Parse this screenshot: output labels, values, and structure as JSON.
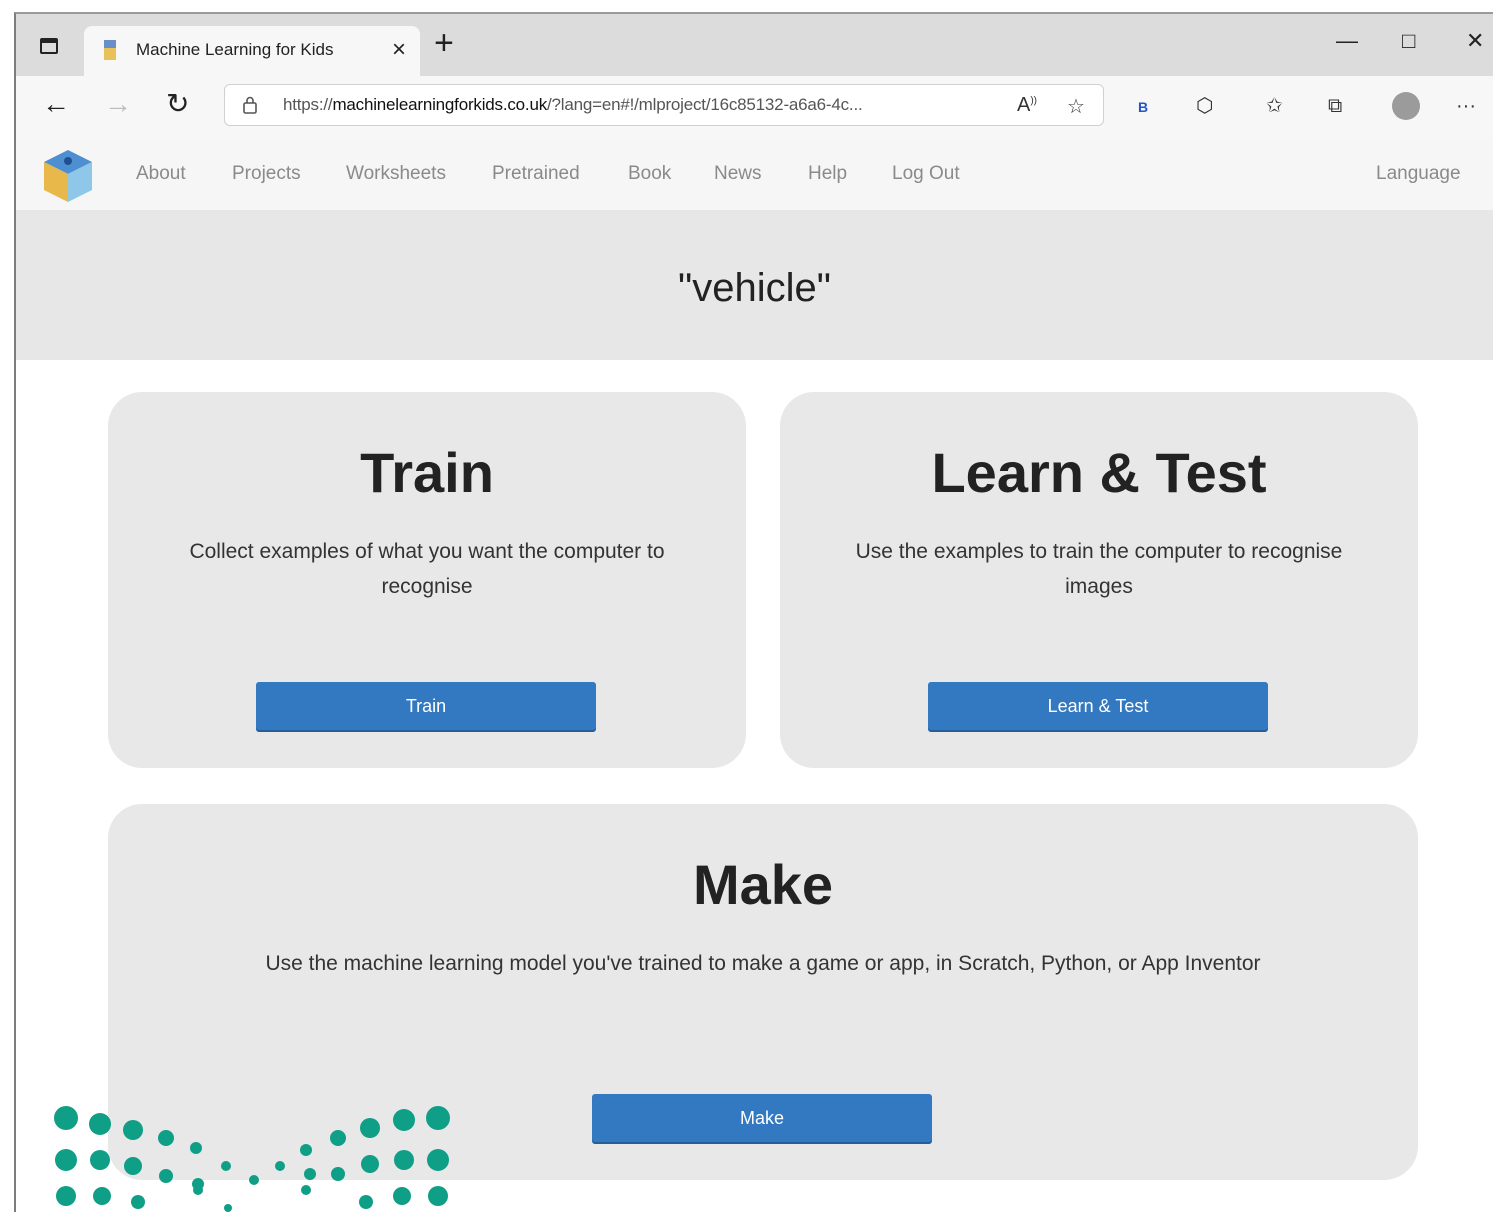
{
  "browser": {
    "tab_title": "Machine Learning for Kids",
    "tab_close": "×",
    "new_tab": "+",
    "window_controls": {
      "minimize": "—",
      "maximize": "□",
      "close": "✕"
    },
    "nav_buttons": {
      "back": "←",
      "forward": "→",
      "refresh": "↻"
    },
    "url_prefix": "https://",
    "url_host": "machinelearningforkids.co.uk",
    "url_path": "/?lang=en#!/mlproject/16c85132-a6a6-4c...",
    "menu": "···"
  },
  "site_nav": {
    "links": [
      "About",
      "Projects",
      "Worksheets",
      "Pretrained",
      "Book",
      "News",
      "Help",
      "Log Out"
    ],
    "language": "Language"
  },
  "project": {
    "title": "\"vehicle\""
  },
  "cards": {
    "train": {
      "heading": "Train",
      "description_line1": "Collect examples of what you want the computer to",
      "description_line2": "recognise",
      "button": "Train"
    },
    "learn": {
      "heading": "Learn & Test",
      "description_line1": "Use the examples to train the computer to recognise",
      "description_line2": "images",
      "button": "Learn & Test"
    },
    "make": {
      "heading": "Make",
      "description": "Use the machine learning model you've trained to make a game or app, in Scratch, Python, or App Inventor",
      "button": "Make"
    }
  },
  "colors": {
    "button_blue": "#3279c1",
    "card_bg": "#e8e8e8",
    "title_band": "#e7e7e7",
    "decoration_teal": "#0f9e86"
  }
}
